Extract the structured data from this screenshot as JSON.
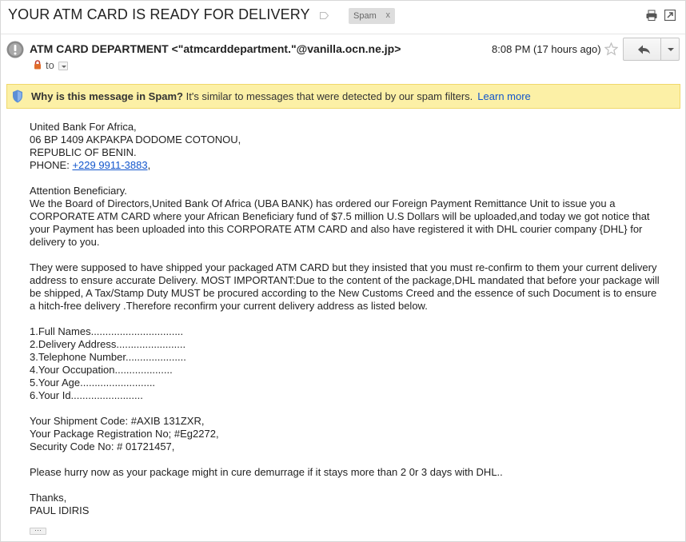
{
  "subject": "YOUR ATM CARD IS READY FOR DELIVERY",
  "spam_chip": {
    "label": "Spam",
    "close": "x"
  },
  "header_icons": [
    "print-icon",
    "open-in-new-window-icon"
  ],
  "sender": {
    "name_and_address": "ATM CARD DEPARTMENT <\"atmcarddepartment.\"@vanilla.ocn.ne.jp>",
    "to_label": "to",
    "time": "8:08 PM (17 hours ago)"
  },
  "banner": {
    "question": "Why is this message in Spam?",
    "explanation": " It's similar to messages that were detected by our spam filters.",
    "learn_more": "Learn more",
    "color": "#fcf0a6"
  },
  "body": {
    "address_lines": [
      "United Bank For Africa,",
      "06 BP 1409 AKPAKPA DODOME COTONOU,",
      "REPUBLIC OF BENIN."
    ],
    "phone_label": "PHONE: ",
    "phone_link": "+229 9911-3883",
    "phone_suffix": ",",
    "para1_lines": [
      "Attention Beneficiary.",
      "We the Board of Directors,United Bank Of Africa (UBA BANK) has ordered our Foreign Payment Remittance Unit to issue you a",
      "CORPORATE ATM CARD where your African Beneficiary fund of $7.5 million U.S Dollars will be uploaded,and today we got notice that",
      "your Payment has been uploaded into this CORPORATE ATM CARD and also have registered it with DHL courier company {DHL} for",
      "delivery to you."
    ],
    "para2_lines": [
      "They were supposed to have shipped your packaged ATM CARD but they insisted that you must re-confirm to them your current delivery",
      "address to ensure accurate Delivery. MOST IMPORTANT:Due to the content of the package,DHL mandated that before your package will",
      "be shipped, A Tax/Stamp Duty MUST be procured according to the New Customs Creed and the essence of such Document is to ensure",
      "a hitch-free delivery .Therefore reconfirm your current delivery address as listed below."
    ],
    "form_lines": [
      "1.Full Names................................",
      "2.Delivery Address........................",
      "3.Telephone Number.....................",
      "4.Your Occupation....................",
      "5.Your Age..........................",
      "6.Your Id........................."
    ],
    "codes_lines": [
      "Your Shipment Code: #AXIB 131ZXR,",
      "Your Package Registration No; #Eg2272,",
      "Security Code No: # 01721457,"
    ],
    "hurry_line": "Please hurry now as your package might in cure demurrage if it stays more than 2 0r 3 days with DHL..",
    "closing_lines": [
      "Thanks,",
      "PAUL IDIRIS"
    ],
    "show_trimmed": "···"
  }
}
